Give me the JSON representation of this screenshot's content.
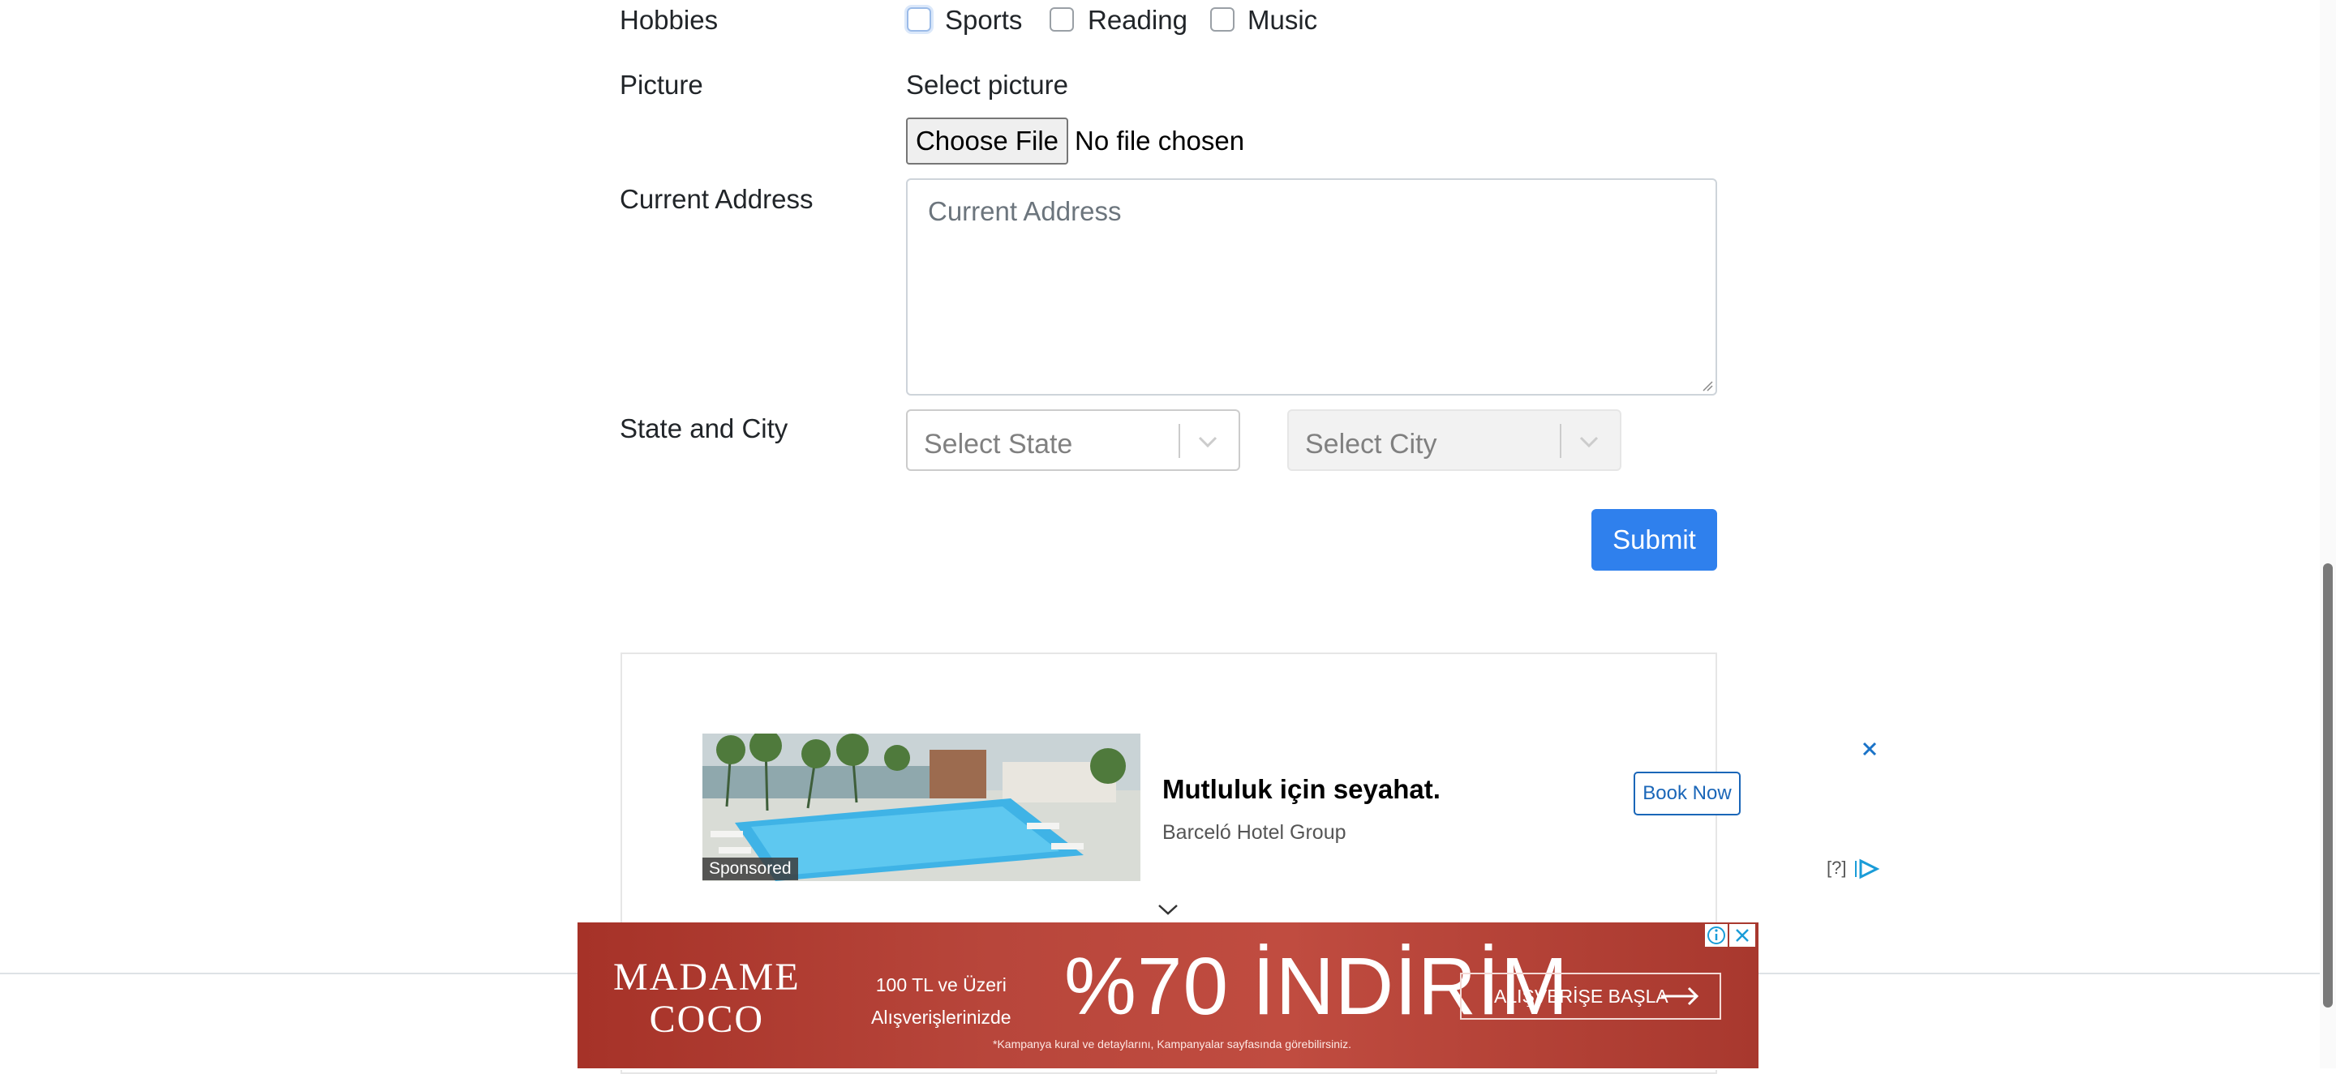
{
  "form": {
    "hobbies_label": "Hobbies",
    "hobbies": [
      {
        "label": "Sports",
        "checked": false
      },
      {
        "label": "Reading",
        "checked": false
      },
      {
        "label": "Music",
        "checked": false
      }
    ],
    "picture_label": "Picture",
    "picture_sublabel": "Select picture",
    "file_button": "Choose File",
    "file_status": "No file chosen",
    "address_label": "Current Address",
    "address_placeholder": "Current Address",
    "state_city_label": "State and City",
    "state_placeholder": "Select State",
    "city_placeholder": "Select City",
    "submit_label": "Submit",
    "submit_color": "#2f80ed"
  },
  "ad": {
    "headline": "Mutluluk için seyahat.",
    "advertiser": "Barceló Hotel Group",
    "cta": "Book Now",
    "sponsored": "Sponsored",
    "help": "[?]",
    "close_icon": "close-icon",
    "adchoices_icon": "adchoices-icon"
  },
  "banner": {
    "brand_line1": "MADAME",
    "brand_line2": "COCO",
    "promo_line1": "100 TL ve Üzeri",
    "promo_line2": "Alışverişlerinizde",
    "headline": "%70 İNDİRİM",
    "cta": "ALIŞVERİŞE BAŞLA",
    "fine_print": "*Kampanya kural ve detaylarını, Kampanyalar sayfasında görebilirsiniz.",
    "background_color": "#b8463b"
  }
}
